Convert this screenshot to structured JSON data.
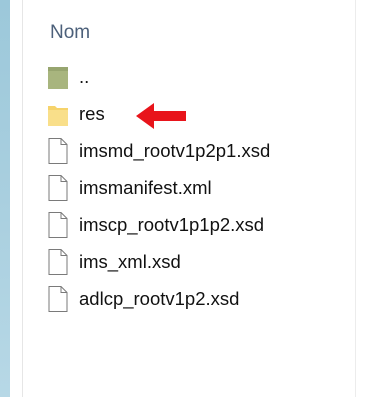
{
  "file_list": {
    "column_header": "Nom",
    "items": [
      {
        "label": "..",
        "icon": "parent-folder-icon",
        "type": "parent"
      },
      {
        "label": "res",
        "icon": "folder-icon",
        "type": "folder"
      },
      {
        "label": "imsmd_rootv1p2p1.xsd",
        "icon": "file-icon",
        "type": "file"
      },
      {
        "label": "imsmanifest.xml",
        "icon": "file-icon",
        "type": "file"
      },
      {
        "label": "imscp_rootv1p1p2.xsd",
        "icon": "file-icon",
        "type": "file"
      },
      {
        "label": "ims_xml.xsd",
        "icon": "file-icon",
        "type": "file"
      },
      {
        "label": "adlcp_rootv1p2.xsd",
        "icon": "file-icon",
        "type": "file"
      }
    ]
  },
  "colors": {
    "header_text": "#4c607a",
    "folder_fill": "#f6d36b",
    "parent_folder_fill": "#a8b57e",
    "arrow": "#e8141b",
    "sidebar_strip": "#a9cfdf"
  }
}
